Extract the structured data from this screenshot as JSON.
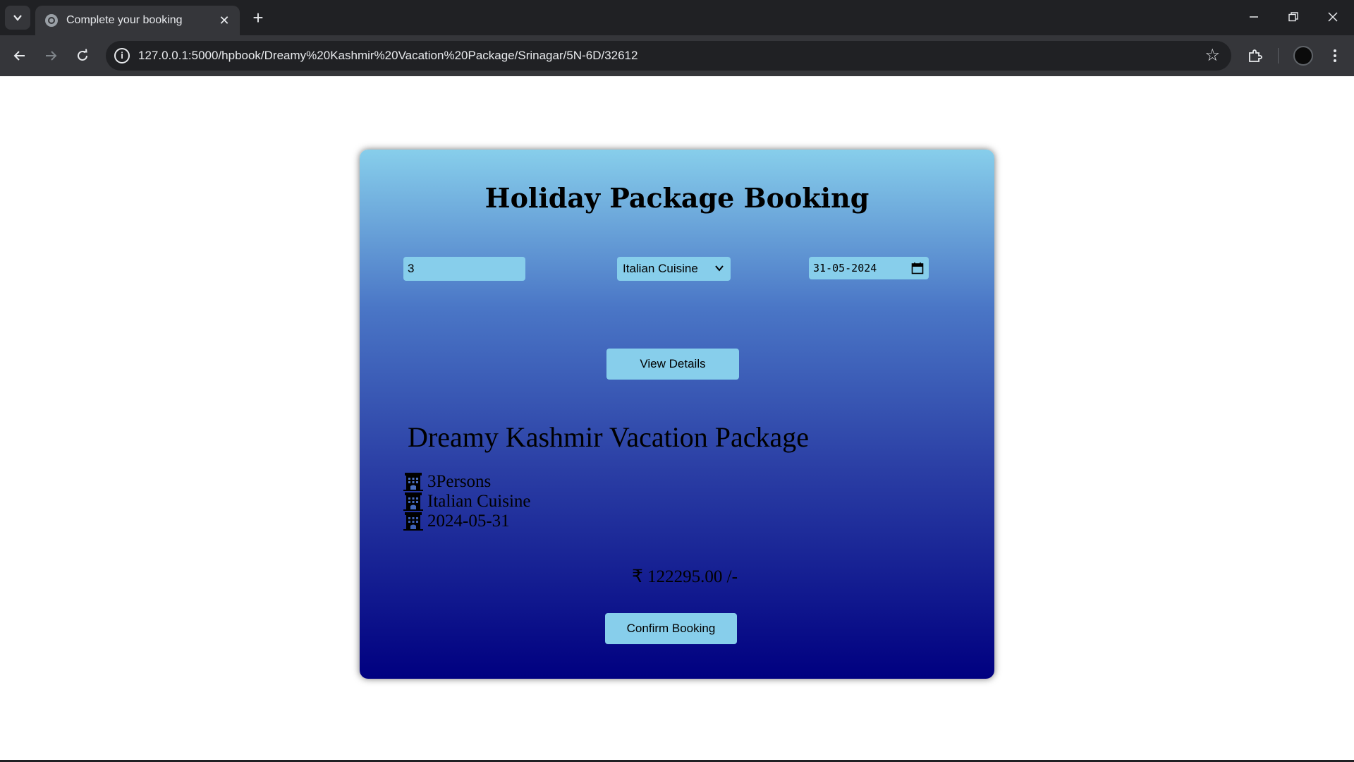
{
  "browser": {
    "tab_title": "Complete your booking",
    "url": "127.0.0.1:5000/hpbook/Dreamy%20Kashmir%20Vacation%20Package/Srinagar/5N-6D/32612"
  },
  "page": {
    "title": "Holiday Package Booking",
    "persons_value": "3",
    "cuisine_selected": "Italian Cuisine",
    "date_value": "31-05-2024",
    "view_details_label": "View Details",
    "package_name": "Dreamy Kashmir Vacation Package",
    "details": [
      {
        "text": "3Persons"
      },
      {
        "text": "Italian Cuisine"
      },
      {
        "text": "2024-05-31"
      }
    ],
    "price": "₹ 122295.00 /-",
    "confirm_label": "Confirm Booking"
  },
  "colors": {
    "accent": "#87ceeb",
    "gradient_top": "#87ceeb",
    "gradient_bottom": "#000080"
  },
  "icons": {
    "detail_icon": "hotel-icon"
  }
}
